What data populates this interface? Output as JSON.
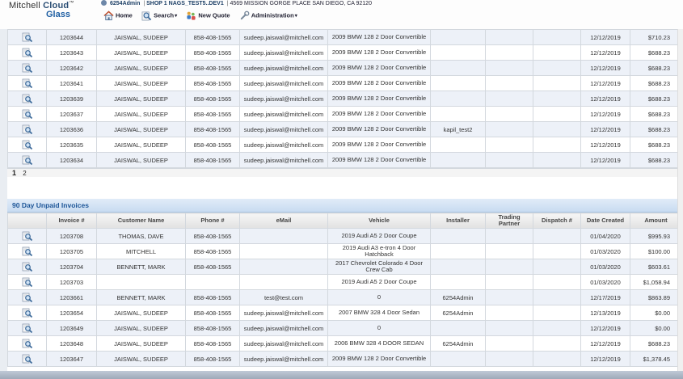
{
  "header": {
    "brand_line1": "Mitchell",
    "brand_cloud": "Cloud",
    "brand_tm": "™",
    "brand_line2": "Glass",
    "user": "6254Admin",
    "shop": "SHOP 1 NAGS_TEST5..DEV1",
    "address": "4569 MISSION GORGE PLACE SAN DIEGO, CA 92120",
    "sep": "|"
  },
  "nav": {
    "home": "Home",
    "search": "Search",
    "new_quote": "New Quote",
    "administration": "Administration",
    "caret": "▾"
  },
  "panel1": {
    "rows": [
      [
        "1203644",
        "JAISWAL, SUDEEP",
        "858-408-1565",
        "sudeep.jaiswal@mitchell.com",
        "2009 BMW 128 2 Door Convertible",
        "",
        "",
        "",
        "12/12/2019",
        "$710.23"
      ],
      [
        "1203643",
        "JAISWAL, SUDEEP",
        "858-408-1565",
        "sudeep.jaiswal@mitchell.com",
        "2009 BMW 128 2 Door Convertible",
        "",
        "",
        "",
        "12/12/2019",
        "$688.23"
      ],
      [
        "1203642",
        "JAISWAL, SUDEEP",
        "858-408-1565",
        "sudeep.jaiswal@mitchell.com",
        "2009 BMW 128 2 Door Convertible",
        "",
        "",
        "",
        "12/12/2019",
        "$688.23"
      ],
      [
        "1203641",
        "JAISWAL, SUDEEP",
        "858-408-1565",
        "sudeep.jaiswal@mitchell.com",
        "2009 BMW 128 2 Door Convertible",
        "",
        "",
        "",
        "12/12/2019",
        "$688.23"
      ],
      [
        "1203639",
        "JAISWAL, SUDEEP",
        "858-408-1565",
        "sudeep.jaiswal@mitchell.com",
        "2009 BMW 128 2 Door Convertible",
        "",
        "",
        "",
        "12/12/2019",
        "$688.23"
      ],
      [
        "1203637",
        "JAISWAL, SUDEEP",
        "858-408-1565",
        "sudeep.jaiswal@mitchell.com",
        "2009 BMW 128 2 Door Convertible",
        "",
        "",
        "",
        "12/12/2019",
        "$688.23"
      ],
      [
        "1203636",
        "JAISWAL, SUDEEP",
        "858-408-1565",
        "sudeep.jaiswal@mitchell.com",
        "2009 BMW 128 2 Door Convertible",
        "kapil_test2",
        "",
        "",
        "12/12/2019",
        "$688.23"
      ],
      [
        "1203635",
        "JAISWAL, SUDEEP",
        "858-408-1565",
        "sudeep.jaiswal@mitchell.com",
        "2009 BMW 128 2 Door Convertible",
        "",
        "",
        "",
        "12/12/2019",
        "$688.23"
      ],
      [
        "1203634",
        "JAISWAL, SUDEEP",
        "858-408-1565",
        "sudeep.jaiswal@mitchell.com",
        "2009 BMW 128 2 Door Convertible",
        "",
        "",
        "",
        "12/12/2019",
        "$688.23"
      ]
    ],
    "pager": [
      "1",
      "2"
    ]
  },
  "panel2": {
    "title": "90 Day Unpaid Invoices",
    "columns": [
      "",
      "Invoice #",
      "Customer Name",
      "Phone #",
      "eMail",
      "Vehicle",
      "Installer",
      "Trading Partner",
      "Dispatch #",
      "Date Created",
      "Amount"
    ],
    "rows": [
      [
        "1203708",
        "THOMAS, DAVE",
        "858-408-1565",
        "",
        "2019 Audi A5 2 Door Coupe",
        "",
        "",
        "",
        "01/04/2020",
        "$995.93"
      ],
      [
        "1203705",
        "MITCHELL",
        "858-408-1565",
        "",
        "2019 Audi A3 e-tron 4 Door Hatchback",
        "",
        "",
        "",
        "01/03/2020",
        "$100.00"
      ],
      [
        "1203704",
        "BENNETT, MARK",
        "858-408-1565",
        "",
        "2017 Chevrolet Colorado 4 Door Crew Cab",
        "",
        "",
        "",
        "01/03/2020",
        "$603.61"
      ],
      [
        "1203703",
        "",
        "",
        "",
        "2019 Audi A5 2 Door Coupe",
        "",
        "",
        "",
        "01/03/2020",
        "$1,058.94"
      ],
      [
        "1203661",
        "BENNETT, MARK",
        "858-408-1565",
        "test@test.com",
        "0",
        "6254Admin",
        "",
        "",
        "12/17/2019",
        "$863.89"
      ],
      [
        "1203654",
        "JAISWAL, SUDEEP",
        "858-408-1565",
        "sudeep.jaiswal@mitchell.com",
        "2007 BMW 328 4 Door Sedan",
        "6254Admin",
        "",
        "",
        "12/13/2019",
        "$0.00"
      ],
      [
        "1203649",
        "JAISWAL, SUDEEP",
        "858-408-1565",
        "sudeep.jaiswal@mitchell.com",
        "0",
        "",
        "",
        "",
        "12/12/2019",
        "$0.00"
      ],
      [
        "1203648",
        "JAISWAL, SUDEEP",
        "858-408-1565",
        "sudeep.jaiswal@mitchell.com",
        "2006 BMW 328 4 DOOR SEDAN",
        "6254Admin",
        "",
        "",
        "12/12/2019",
        "$688.23"
      ],
      [
        "1203647",
        "JAISWAL, SUDEEP",
        "858-408-1565",
        "sudeep.jaiswal@mitchell.com",
        "2009 BMW 128 2 Door Convertible",
        "",
        "",
        "",
        "12/12/2019",
        "$1,378.45"
      ]
    ]
  },
  "icons": {
    "row_action": "magnifier-document-icon",
    "home": "house-icon",
    "search": "magnifier-icon",
    "new_quote": "people-document-icon",
    "administration": "wrench-icon"
  }
}
